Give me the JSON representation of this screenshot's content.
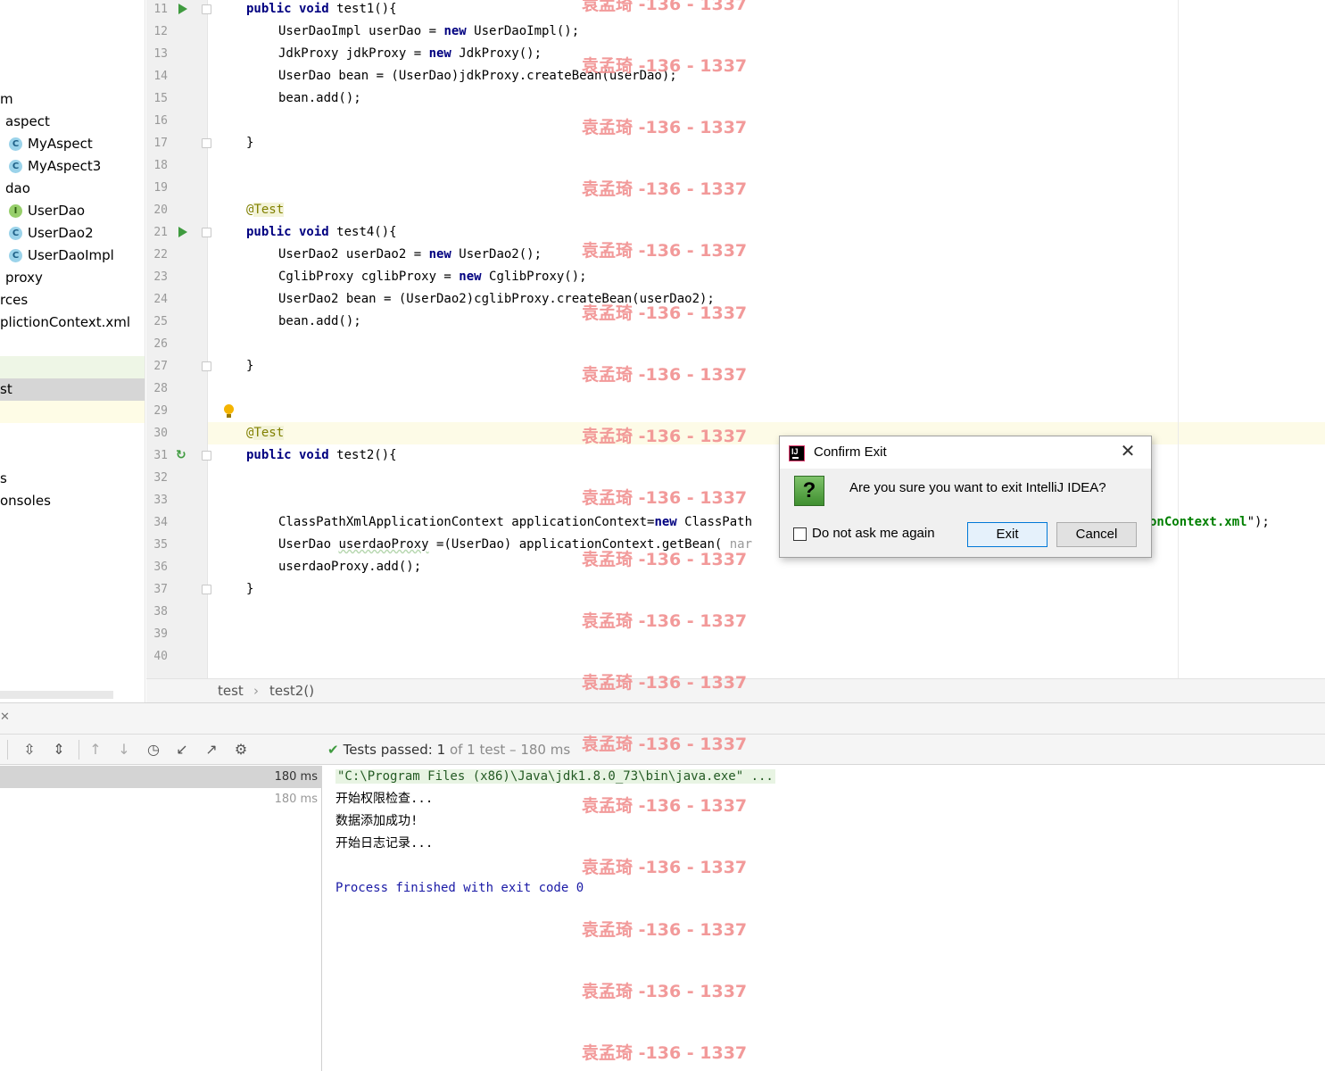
{
  "project_tree": {
    "rows": [
      {
        "label": "m",
        "icon": "",
        "indent": 0,
        "highlight": ""
      },
      {
        "label": "aspect",
        "icon": "",
        "indent": 6,
        "highlight": ""
      },
      {
        "label": "MyAspect",
        "icon": "C",
        "indent": 31,
        "highlight": ""
      },
      {
        "label": "MyAspect3",
        "icon": "C",
        "indent": 31,
        "highlight": ""
      },
      {
        "label": "dao",
        "icon": "",
        "indent": 6,
        "highlight": ""
      },
      {
        "label": "UserDao",
        "icon": "I",
        "indent": 31,
        "highlight": ""
      },
      {
        "label": "UserDao2",
        "icon": "C",
        "indent": 31,
        "highlight": ""
      },
      {
        "label": "UserDaoImpl",
        "icon": "C",
        "indent": 31,
        "highlight": ""
      },
      {
        "label": "proxy",
        "icon": "",
        "indent": 6,
        "highlight": ""
      },
      {
        "label": "rces",
        "icon": "",
        "indent": 0,
        "highlight": ""
      },
      {
        "label": "pliction​Context.xml",
        "icon": "",
        "indent": 0,
        "highlight": ""
      },
      {
        "label": "",
        "icon": "",
        "indent": 0,
        "highlight": ""
      },
      {
        "label": "",
        "icon": "",
        "indent": 0,
        "highlight": "green"
      },
      {
        "label": "st",
        "icon": "",
        "indent": 0,
        "highlight": "gray"
      },
      {
        "label": "",
        "icon": "",
        "indent": 0,
        "highlight": "yellow"
      },
      {
        "label": "",
        "icon": "",
        "indent": 0,
        "highlight": ""
      },
      {
        "label": "",
        "icon": "",
        "indent": 0,
        "highlight": ""
      },
      {
        "label": "s",
        "icon": "",
        "indent": 0,
        "highlight": ""
      },
      {
        "label": "onsoles",
        "icon": "",
        "indent": 0,
        "highlight": ""
      }
    ]
  },
  "editor": {
    "lines": [
      {
        "n": "11",
        "gutter": "run",
        "fold": true,
        "html": [
          {
            "t": "public void ",
            "c": "kw"
          },
          {
            "t": "test1(){",
            "c": ""
          }
        ],
        "indent": 0
      },
      {
        "n": "12",
        "gutter": "",
        "fold": false,
        "html": [
          {
            "t": "UserDaoImpl userDao = ",
            "c": ""
          },
          {
            "t": "new ",
            "c": "kw"
          },
          {
            "t": "UserDaoImpl();",
            "c": ""
          }
        ],
        "indent": 1
      },
      {
        "n": "13",
        "gutter": "",
        "fold": false,
        "html": [
          {
            "t": "JdkProxy jdkProxy = ",
            "c": ""
          },
          {
            "t": "new ",
            "c": "kw"
          },
          {
            "t": "JdkProxy();",
            "c": ""
          }
        ],
        "indent": 1
      },
      {
        "n": "14",
        "gutter": "",
        "fold": false,
        "html": [
          {
            "t": "UserDao bean = (UserDao)jdkProxy.createBean(userDao);",
            "c": ""
          }
        ],
        "indent": 1
      },
      {
        "n": "15",
        "gutter": "",
        "fold": false,
        "html": [
          {
            "t": "bean.add();",
            "c": ""
          }
        ],
        "indent": 1
      },
      {
        "n": "16",
        "gutter": "",
        "fold": false,
        "html": [],
        "indent": 0
      },
      {
        "n": "17",
        "gutter": "",
        "fold": true,
        "html": [
          {
            "t": "}",
            "c": ""
          }
        ],
        "indent": 0
      },
      {
        "n": "18",
        "gutter": "",
        "fold": false,
        "html": [],
        "indent": 0
      },
      {
        "n": "19",
        "gutter": "",
        "fold": false,
        "html": [],
        "indent": 0
      },
      {
        "n": "20",
        "gutter": "",
        "fold": false,
        "html": [
          {
            "t": "@",
            "c": "an"
          },
          {
            "t": "Test",
            "c": "an at"
          }
        ],
        "indent": 0
      },
      {
        "n": "21",
        "gutter": "run",
        "fold": true,
        "html": [
          {
            "t": "public void ",
            "c": "kw"
          },
          {
            "t": "test4(){",
            "c": ""
          }
        ],
        "indent": 0
      },
      {
        "n": "22",
        "gutter": "",
        "fold": false,
        "html": [
          {
            "t": "UserDao2 userDao2 = ",
            "c": ""
          },
          {
            "t": "new ",
            "c": "kw"
          },
          {
            "t": "UserDao2();",
            "c": ""
          }
        ],
        "indent": 1
      },
      {
        "n": "23",
        "gutter": "",
        "fold": false,
        "html": [
          {
            "t": "CglibProxy cglibProxy = ",
            "c": ""
          },
          {
            "t": "new ",
            "c": "kw"
          },
          {
            "t": "CglibProxy();",
            "c": ""
          }
        ],
        "indent": 1
      },
      {
        "n": "24",
        "gutter": "",
        "fold": false,
        "html": [
          {
            "t": "UserDao2 bean = (UserDao2)cglibProxy.createBean(userDao2);",
            "c": ""
          }
        ],
        "indent": 1
      },
      {
        "n": "25",
        "gutter": "",
        "fold": false,
        "html": [
          {
            "t": "bean.add();",
            "c": ""
          }
        ],
        "indent": 1
      },
      {
        "n": "26",
        "gutter": "",
        "fold": false,
        "html": [],
        "indent": 0
      },
      {
        "n": "27",
        "gutter": "",
        "fold": true,
        "html": [
          {
            "t": "}",
            "c": ""
          }
        ],
        "indent": 0
      },
      {
        "n": "28",
        "gutter": "",
        "fold": false,
        "html": [],
        "indent": 0
      },
      {
        "n": "29",
        "gutter": "bulb",
        "fold": false,
        "html": [],
        "indent": 0
      },
      {
        "n": "30",
        "gutter": "",
        "fold": false,
        "html": [
          {
            "t": "@",
            "c": "an"
          },
          {
            "t": "Test",
            "c": "an at"
          }
        ],
        "indent": 0
      },
      {
        "n": "31",
        "gutter": "rerun",
        "fold": true,
        "html": [
          {
            "t": "public void ",
            "c": "kw"
          },
          {
            "t": "test2(){",
            "c": ""
          }
        ],
        "indent": 0
      },
      {
        "n": "32",
        "gutter": "",
        "fold": false,
        "html": [],
        "indent": 0
      },
      {
        "n": "33",
        "gutter": "",
        "fold": false,
        "html": [],
        "indent": 0
      },
      {
        "n": "34",
        "gutter": "",
        "fold": false,
        "html": [
          {
            "t": "ClassPathXmlApplicationContext applicationContext=",
            "c": ""
          },
          {
            "t": "new ",
            "c": "kw"
          },
          {
            "t": "ClassPath",
            "c": ""
          }
        ],
        "indent": 1
      },
      {
        "n": "35",
        "gutter": "",
        "fold": false,
        "html": [
          {
            "t": "UserDao ",
            "c": ""
          },
          {
            "t": "userdaoProxy",
            "c": "warn"
          },
          {
            "t": " =(UserDao) applicationContext.getBean( ",
            "c": ""
          },
          {
            "t": "nar",
            "c": "hint"
          }
        ],
        "indent": 1
      },
      {
        "n": "36",
        "gutter": "",
        "fold": false,
        "html": [
          {
            "t": "userdaoProxy.add();",
            "c": ""
          }
        ],
        "indent": 1
      },
      {
        "n": "37",
        "gutter": "",
        "fold": true,
        "html": [
          {
            "t": "}",
            "c": ""
          }
        ],
        "indent": 0
      },
      {
        "n": "38",
        "gutter": "",
        "fold": false,
        "html": [],
        "indent": 0
      },
      {
        "n": "39",
        "gutter": "",
        "fold": false,
        "html": [],
        "indent": 0
      },
      {
        "n": "40",
        "gutter": "",
        "fold": false,
        "html": [],
        "indent": 0
      }
    ],
    "line34_tail": "onContext.xml",
    "line34_tail_end": "\");"
  },
  "breadcrumb": {
    "class": "test",
    "separator": "›",
    "method": "test2()"
  },
  "run": {
    "status_passed": "Tests passed: ",
    "status_count": "1",
    "status_rest": " of 1 test – 180 ms",
    "tests": [
      {
        "duration": "180 ms",
        "selected": true
      },
      {
        "duration": "180 ms",
        "selected": false
      }
    ],
    "console": [
      {
        "text": "\"C:\\Program Files (x86)\\Java\\jdk1.8.0_73\\bin\\java.exe\" ...",
        "style": "cmd"
      },
      {
        "text": "开始权限检查...",
        "style": ""
      },
      {
        "text": "数据添加成功!",
        "style": ""
      },
      {
        "text": "开始日志记录...",
        "style": ""
      },
      {
        "text": "",
        "style": ""
      },
      {
        "text": "Process finished with exit code 0",
        "style": "blue"
      }
    ]
  },
  "watermark": "袁孟琦 -136 - 1337",
  "dialog": {
    "title": "Confirm Exit",
    "message": "Are you sure you want to exit IntelliJ IDEA?",
    "checkbox_label": "Do not ask me again",
    "exit_label": "Exit",
    "cancel_label": "Cancel"
  }
}
